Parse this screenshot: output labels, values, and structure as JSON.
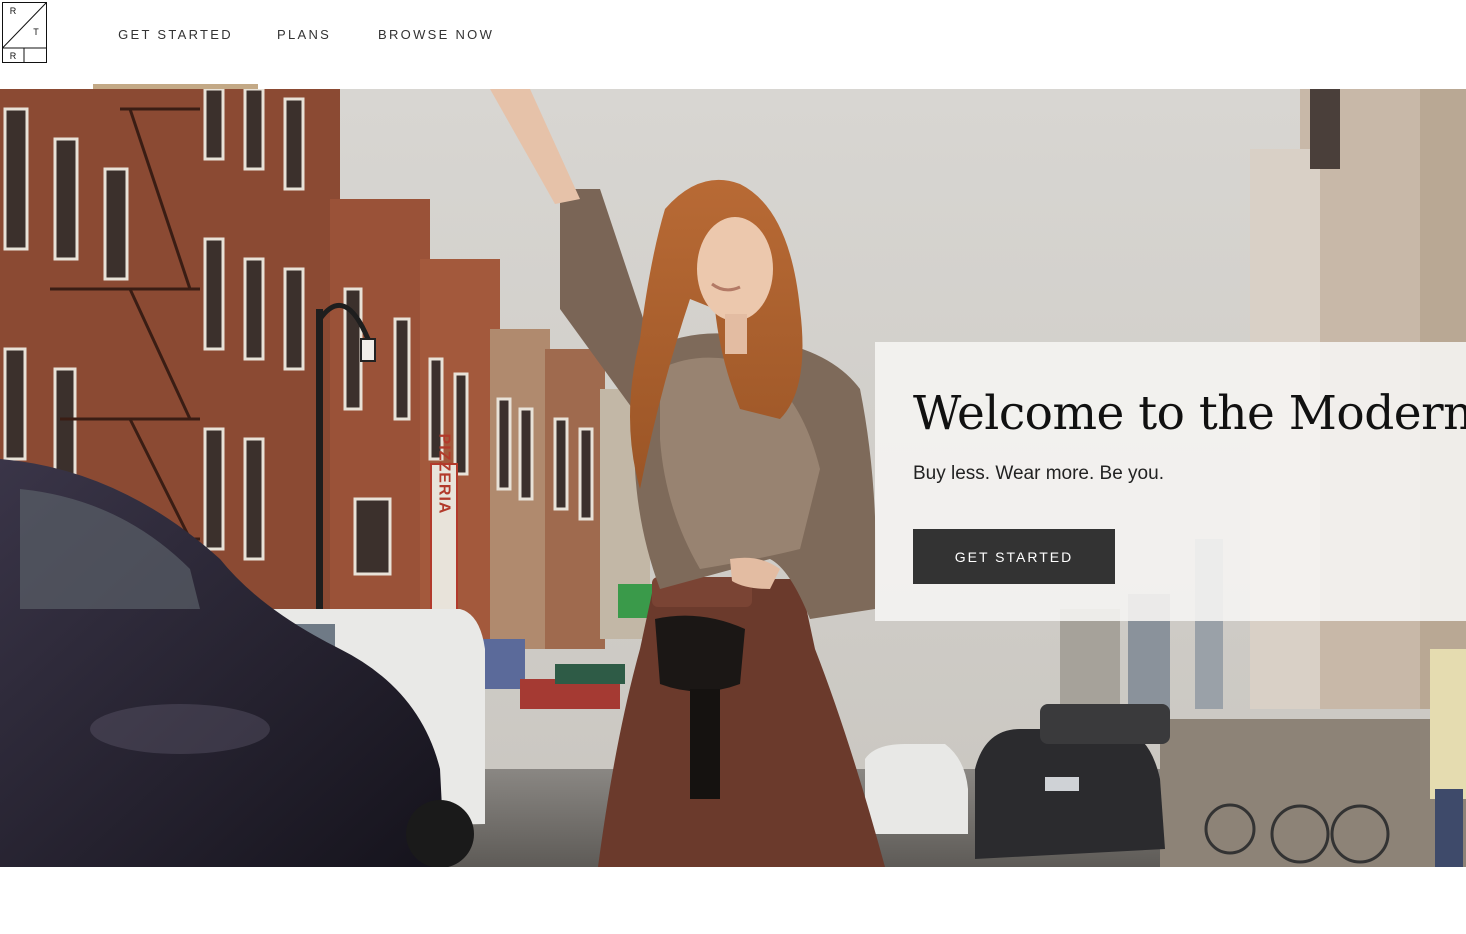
{
  "logo": {
    "letters": [
      "R",
      "T",
      "R"
    ]
  },
  "nav": {
    "items": [
      {
        "label": "GET STARTED",
        "active": true
      },
      {
        "label": "PLANS",
        "active": false
      },
      {
        "label": "BROWSE NOW",
        "active": false
      }
    ]
  },
  "hero": {
    "title": "Welcome to the Modern",
    "subtitle": "Buy less. Wear more. Be you.",
    "cta_label": "GET STARTED",
    "signs": {
      "pizzeria": "PIZZERIA"
    }
  },
  "colors": {
    "accent": "#c3a986",
    "button": "#333333",
    "text": "#333333"
  }
}
